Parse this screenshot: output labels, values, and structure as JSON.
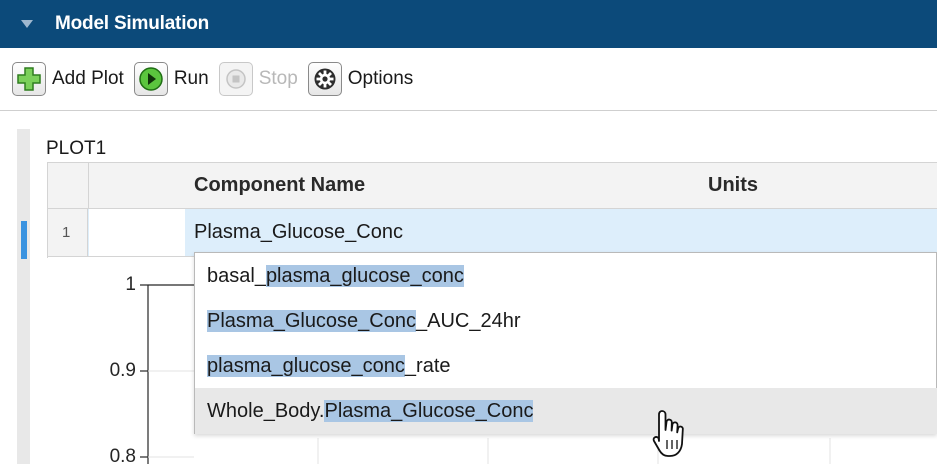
{
  "header": {
    "title": "Model Simulation"
  },
  "toolbar": {
    "add_plot": "Add Plot",
    "run": "Run",
    "stop": "Stop",
    "options": "Options"
  },
  "plot": {
    "label": "PLOT1",
    "columns": [
      "Component Name",
      "Units"
    ],
    "rows": [
      {
        "num": "1",
        "component": "Plasma_Glucose_Conc",
        "units": ""
      }
    ]
  },
  "dropdown": {
    "items": [
      {
        "prefix": "basal_",
        "match": "plasma_glucose_conc",
        "suffix": ""
      },
      {
        "prefix": "",
        "match": "Plasma_Glucose_Conc",
        "suffix": "_AUC_24hr"
      },
      {
        "prefix": "",
        "match": "plasma_glucose_conc",
        "suffix": "_rate"
      },
      {
        "prefix": "Whole_Body.",
        "match": "Plasma_Glucose_Conc",
        "suffix": ""
      }
    ],
    "hovered_index": 3
  },
  "chart": {
    "yticks": [
      "1",
      "0.9",
      "0.8"
    ]
  },
  "colors": {
    "header_bg": "#0c4a7a",
    "selection_bg": "#ddeefb",
    "match_highlight": "#a9c6e4",
    "row_indicator": "#3a93e0"
  },
  "icons": [
    "collapse-triangle-icon",
    "add-icon",
    "run-icon",
    "stop-icon",
    "gear-icon",
    "hand-pointer-cursor"
  ]
}
